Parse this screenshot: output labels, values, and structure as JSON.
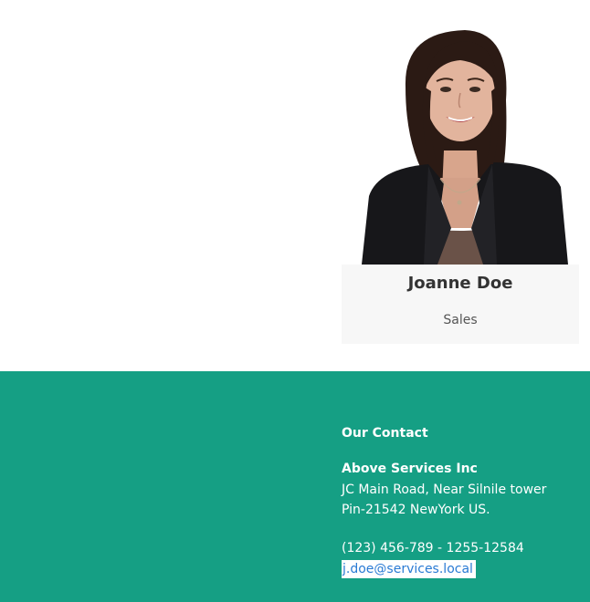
{
  "team_member": {
    "name": "Joanne Doe",
    "role": "Sales"
  },
  "footer": {
    "heading": "Our Contact",
    "company": "Above Services Inc",
    "address_line1": "JC Main Road, Near Silnile tower",
    "address_line2": "Pin-21542 NewYork US.",
    "phone": "(123) 456-789 - 1255-12584",
    "email": "j.doe@services.local"
  },
  "colors": {
    "footer_background": "#159f84",
    "card_background": "#f7f7f7",
    "link": "#2a7bd4"
  }
}
